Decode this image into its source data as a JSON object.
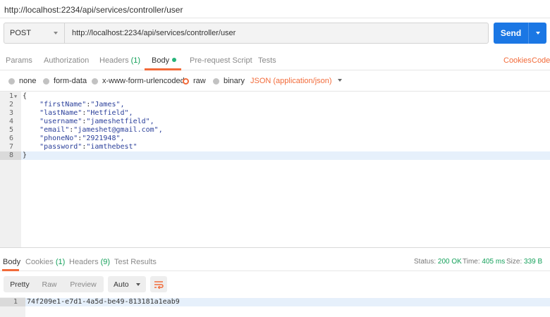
{
  "window": {
    "title": "http://localhost:2234/api/services/controller/user"
  },
  "request": {
    "method": "POST",
    "url": "http://localhost:2234/api/services/controller/user",
    "send_label": "Send"
  },
  "request_tabs": {
    "params": "Params",
    "authorization": "Authorization",
    "headers": "Headers",
    "headers_count": "(1)",
    "body": "Body",
    "pre_request": "Pre-request Script",
    "tests": "Tests",
    "cookies": "Cookies",
    "code": "Code"
  },
  "body_types": {
    "none": "none",
    "form_data": "form-data",
    "urlencoded": "x-www-form-urlencoded",
    "raw": "raw",
    "binary": "binary",
    "selected": "raw",
    "content_type": "JSON (application/json)"
  },
  "editor": {
    "line_numbers": [
      "1",
      "2",
      "3",
      "4",
      "5",
      "6",
      "7",
      "8"
    ],
    "open_brace": "{",
    "close_brace": "}",
    "fields": [
      {
        "key": "\"firstName\"",
        "value": "\"James\","
      },
      {
        "key": "\"lastName\"",
        "value": "\"Hetfield\","
      },
      {
        "key": "\"username\"",
        "value": "\"jameshetfield\","
      },
      {
        "key": "\"email\"",
        "value": "\"jameshet@gmail.com\","
      },
      {
        "key": "\"phoneNo\"",
        "value": "\"2921948\","
      },
      {
        "key": "\"password\"",
        "value": "\"iamthebest\""
      }
    ]
  },
  "response_tabs": {
    "body": "Body",
    "cookies": "Cookies",
    "cookies_count": "(1)",
    "headers": "Headers",
    "headers_count": "(9)",
    "test_results": "Test Results"
  },
  "response_status": {
    "status_label": "Status:",
    "status_value": "200 OK",
    "time_label": "Time:",
    "time_value": "405 ms",
    "size_label": "Size:",
    "size_value": "339 B"
  },
  "response_view": {
    "pretty": "Pretty",
    "raw": "Raw",
    "preview": "Preview",
    "format": "Auto"
  },
  "response_body": {
    "line_number": "1",
    "content": "74f209e1-e7d1-4a5d-be49-813181a1eab9"
  },
  "colors": {
    "accent": "#f26b3a",
    "send": "#1b77e4",
    "count": "#14a05a"
  }
}
